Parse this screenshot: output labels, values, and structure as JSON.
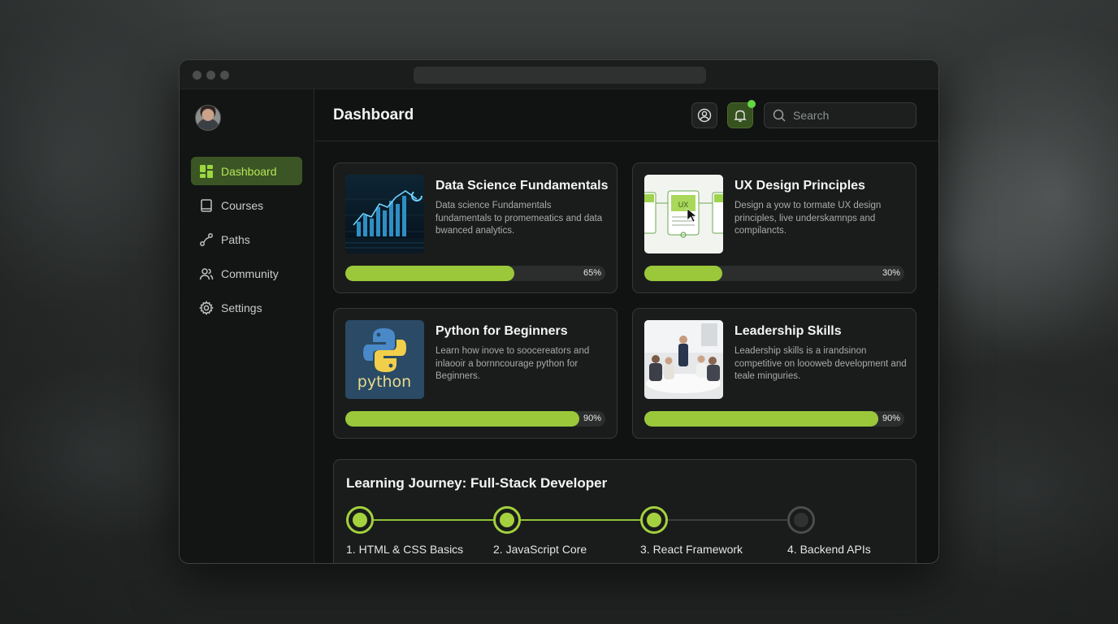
{
  "sidebar": {
    "items": [
      {
        "label": "Dashboard",
        "icon": "dashboard-icon",
        "active": true
      },
      {
        "label": "Courses",
        "icon": "book-icon",
        "active": false
      },
      {
        "label": "Paths",
        "icon": "route-icon",
        "active": false
      },
      {
        "label": "Community",
        "icon": "users-icon",
        "active": false
      },
      {
        "label": "Settings",
        "icon": "gear-icon",
        "active": false
      }
    ]
  },
  "header": {
    "title": "Dashboard",
    "search_placeholder": "Search"
  },
  "courses": [
    {
      "title": "Data Science Fundamentals",
      "description": "Data science Fundamentals fundamentals to promemeatics and data bwanced analytics.",
      "progress": 65,
      "progress_label": "65%"
    },
    {
      "title": "UX Design Principles",
      "description": "Design a yow to tormate UX design principles, live underskamnps and compilancts.",
      "progress": 30,
      "progress_label": "30%"
    },
    {
      "title": "Python for Beginners",
      "description": "Learn how inove to soocereators and inlaooir a bornncourage python for Beginners.",
      "progress": 90,
      "progress_label": "90%"
    },
    {
      "title": "Leadership Skills",
      "description": "Leadership skills is a irandsinon competitive on loooweb development and teale minguries.",
      "progress": 90,
      "progress_label": "90%"
    }
  ],
  "thumbs": {
    "ux_label": "UX",
    "python_label": "python"
  },
  "journey": {
    "title": "Learning Journey: Full-Stack Developer",
    "steps": [
      {
        "label": "1. HTML & CSS Basics",
        "completed": true
      },
      {
        "label": "2. JavaScript Core",
        "completed": true
      },
      {
        "label": "3. React Framework",
        "completed": true
      },
      {
        "label": "4. Backend APIs",
        "completed": false
      }
    ]
  },
  "colors": {
    "accent": "#9bc83a",
    "active_bg": "#3b5624",
    "notification_dot": "#63d644"
  }
}
